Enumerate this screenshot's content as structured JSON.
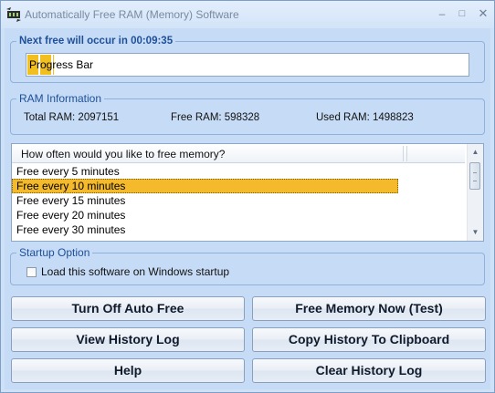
{
  "window": {
    "title": "Automatically Free RAM (Memory) Software",
    "controls": {
      "minimize": "–",
      "maximize": "□",
      "close": "✕"
    }
  },
  "timer": {
    "label": "Next free will occur in 00:09:35",
    "progress_text": "Progress Bar",
    "progress_fraction": 0.06
  },
  "ram": {
    "label": "RAM Information",
    "total": "Total RAM: 2097151",
    "free": "Free RAM: 598328",
    "used": "Used RAM: 1498823"
  },
  "frequency_list": {
    "header": "How often would you like to free memory?",
    "items": [
      "Free every 5 minutes",
      "Free every 10 minutes",
      "Free every 15 minutes",
      "Free every 20 minutes",
      "Free every 30 minutes"
    ],
    "selected_index": 1
  },
  "startup": {
    "label": "Startup Option",
    "checkbox_label": "Load this software on Windows startup",
    "checked": false
  },
  "buttons": {
    "turn_off_auto_free": "Turn Off Auto Free",
    "free_memory_now": "Free Memory Now (Test)",
    "view_history_log": "View History Log",
    "copy_history": "Copy History To Clipboard",
    "help": "Help",
    "clear_history_log": "Clear History Log"
  },
  "colors": {
    "selection": "#f4ba2b",
    "group_label": "#1f4f99",
    "window_bg": "#c6dcf6"
  }
}
